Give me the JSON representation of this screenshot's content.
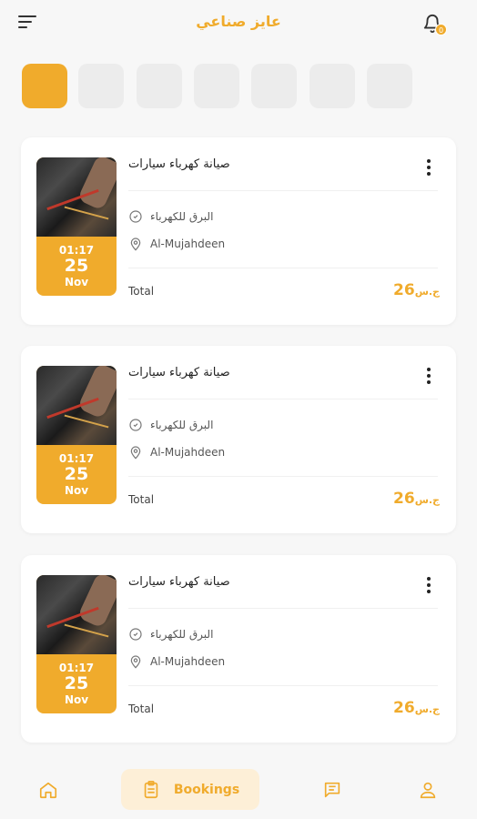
{
  "header": {
    "title": "عايز صناعي",
    "notification_count": "0"
  },
  "bookings": [
    {
      "time": "01:17",
      "day": "25",
      "month": "Nov",
      "title": "صيانة كهرباء سيارات",
      "provider": "البرق للكهرباء",
      "location": "Al-Mujahdeen",
      "total_label": "Total",
      "price": "26",
      "currency": "ج.س"
    },
    {
      "time": "01:17",
      "day": "25",
      "month": "Nov",
      "title": "صيانة كهرباء سيارات",
      "provider": "البرق للكهرباء",
      "location": "Al-Mujahdeen",
      "total_label": "Total",
      "price": "26",
      "currency": "ج.س"
    },
    {
      "time": "01:17",
      "day": "25",
      "month": "Nov",
      "title": "صيانة كهرباء سيارات",
      "provider": "البرق للكهرباء",
      "location": "Al-Mujahdeen",
      "total_label": "Total",
      "price": "26",
      "currency": "ج.س"
    }
  ],
  "bottom_nav": {
    "home_icon": "home-icon",
    "bookings_label": "Bookings",
    "bookings_icon": "clipboard-icon",
    "messages_icon": "chat-icon",
    "profile_icon": "user-icon"
  },
  "colors": {
    "accent": "#f0ab2c",
    "background": "#f7f7f7",
    "chip_inactive": "#ececec"
  }
}
